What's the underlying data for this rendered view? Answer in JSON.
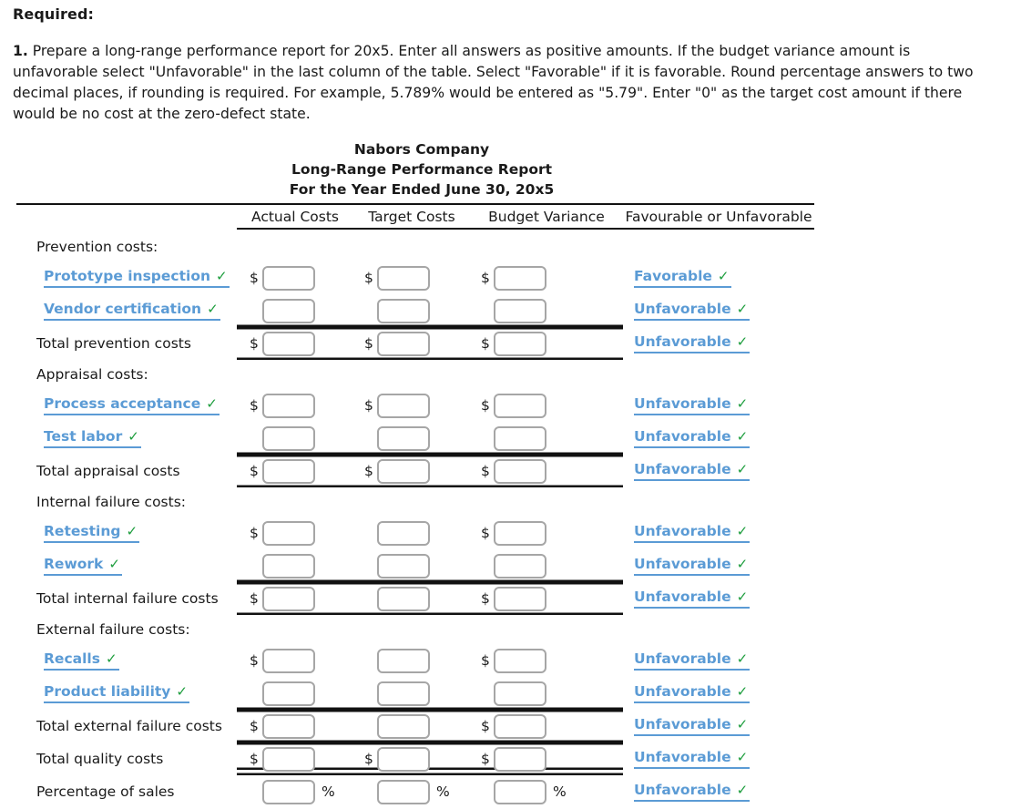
{
  "instructions": {
    "heading": "Required:",
    "q_num": "1.",
    "body": " Prepare a long-range performance report for 20x5. Enter all answers as positive amounts. If the budget variance amount is unfavorable select \"Unfavorable\" in the last column of the table. Select \"Favorable\" if it is favorable. Round percentage answers to two decimal places, if rounding is required. For example, 5.789% would be entered as \"5.79\". Enter \"0\" as the target cost amount if there would be no cost at the zero-defect state."
  },
  "report": {
    "title_line1": "Nabors Company",
    "title_line2": "Long-Range Performance Report",
    "title_line3": "For the Year Ended June 30, 20x5",
    "columns": [
      "",
      "Actual Costs",
      "Target Costs",
      "Budget Variance",
      "Favourable or Unfavorable"
    ],
    "currency_symbol": "$",
    "percent_symbol": "%",
    "check_glyph": "✓",
    "accent_blue": "#5b9bd5",
    "check_green": "#1e9e3e",
    "rows": [
      {
        "kind": "section",
        "label": "Prevention costs:"
      },
      {
        "kind": "item",
        "select_label": "Prototype inspection",
        "actual_dollar": true,
        "target_dollar": true,
        "variance_dollar": true,
        "fav": "Favorable"
      },
      {
        "kind": "item",
        "select_label": "Vendor certification",
        "actual_dollar": false,
        "target_dollar": false,
        "variance_dollar": false,
        "fav": "Unfavorable",
        "rule": "bottom"
      },
      {
        "kind": "total",
        "label": "Total prevention costs",
        "actual_dollar": true,
        "target_dollar": true,
        "variance_dollar": true,
        "fav": "Unfavorable",
        "rule": "bottom"
      },
      {
        "kind": "section",
        "label": "Appraisal costs:"
      },
      {
        "kind": "item",
        "select_label": "Process acceptance",
        "actual_dollar": true,
        "target_dollar": true,
        "variance_dollar": true,
        "fav": "Unfavorable"
      },
      {
        "kind": "item",
        "select_label": "Test labor",
        "actual_dollar": false,
        "target_dollar": false,
        "variance_dollar": false,
        "fav": "Unfavorable",
        "rule": "bottom"
      },
      {
        "kind": "total",
        "label": "Total appraisal costs",
        "actual_dollar": true,
        "target_dollar": true,
        "variance_dollar": true,
        "fav": "Unfavorable",
        "rule": "bottom"
      },
      {
        "kind": "section",
        "label": "Internal failure costs:"
      },
      {
        "kind": "item",
        "select_label": "Retesting",
        "actual_dollar": true,
        "target_dollar": false,
        "variance_dollar": true,
        "fav": "Unfavorable"
      },
      {
        "kind": "item",
        "select_label": "Rework",
        "actual_dollar": false,
        "target_dollar": false,
        "variance_dollar": false,
        "fav": "Unfavorable",
        "rule": "bottom"
      },
      {
        "kind": "total",
        "label": "Total internal failure costs",
        "actual_dollar": true,
        "target_dollar": false,
        "variance_dollar": true,
        "fav": "Unfavorable",
        "rule": "bottom"
      },
      {
        "kind": "section",
        "label": "External failure costs:"
      },
      {
        "kind": "item",
        "select_label": "Recalls",
        "actual_dollar": true,
        "target_dollar": false,
        "variance_dollar": true,
        "fav": "Unfavorable"
      },
      {
        "kind": "item",
        "select_label": "Product liability",
        "actual_dollar": false,
        "target_dollar": false,
        "variance_dollar": false,
        "fav": "Unfavorable",
        "rule": "bottom"
      },
      {
        "kind": "total",
        "label": "Total external failure costs",
        "actual_dollar": true,
        "target_dollar": false,
        "variance_dollar": true,
        "fav": "Unfavorable",
        "rule": "bottom"
      },
      {
        "kind": "total",
        "label": "Total quality costs",
        "actual_dollar": true,
        "target_dollar": true,
        "variance_dollar": true,
        "fav": "Unfavorable",
        "rule": "dbl"
      },
      {
        "kind": "percent",
        "label": "Percentage of sales",
        "actual_dollar": false,
        "target_dollar": false,
        "variance_dollar": false,
        "fav": "Unfavorable"
      }
    ]
  }
}
